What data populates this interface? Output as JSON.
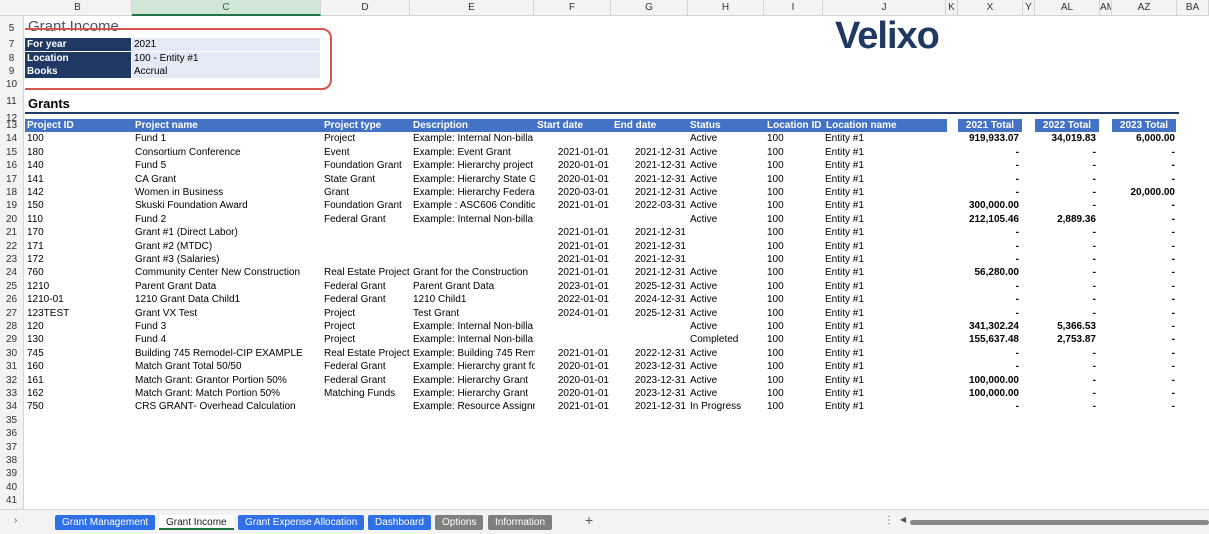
{
  "columns": [
    "B",
    "C",
    "D",
    "E",
    "F",
    "G",
    "H",
    "I",
    "J",
    "K",
    "X",
    "Y",
    "AL",
    "AM",
    "AZ",
    "BA"
  ],
  "selected_column": "C",
  "row_numbers": [
    "5",
    "7",
    "8",
    "9",
    "10",
    "11",
    "12",
    "13",
    "14",
    "15",
    "16",
    "17",
    "18",
    "19",
    "20",
    "21",
    "22",
    "23",
    "24",
    "25",
    "26",
    "27",
    "28",
    "29",
    "30",
    "31",
    "32",
    "33",
    "34",
    "35",
    "36",
    "37",
    "38",
    "39",
    "40",
    "41"
  ],
  "sheet_title": "Grant Income",
  "params": [
    {
      "label": "For year",
      "value": "2021"
    },
    {
      "label": "Location",
      "value": "100 - Entity #1"
    },
    {
      "label": "Books",
      "value": "Accrual"
    }
  ],
  "logo_text": "Velixo",
  "grants_title": "Grants",
  "table": {
    "headers": [
      "Project ID",
      "Project name",
      "Project type",
      "Description",
      "Start date",
      "End date",
      "Status",
      "Location ID",
      "Location name"
    ],
    "total_headers": [
      "2021 Total",
      "2022 Total",
      "2023 Total"
    ],
    "rows": [
      {
        "id": "100",
        "name": "Fund 1",
        "type": "Project",
        "desc": "Example: Internal Non-billa",
        "start": "",
        "end": "",
        "status": "Active",
        "loc": "100",
        "locname": "Entity #1",
        "t2021": "919,933.07",
        "t2022": "34,019.83",
        "t2023": "6,000.00"
      },
      {
        "id": "180",
        "name": "Consortium Conference",
        "type": "Event",
        "desc": "Example: Event Grant",
        "start": "2021-01-01",
        "end": "2021-12-31",
        "status": "Active",
        "loc": "100",
        "locname": "Entity #1",
        "t2021": "-",
        "t2022": "-",
        "t2023": "-"
      },
      {
        "id": "140",
        "name": "Fund 5",
        "type": "Foundation Grant",
        "desc": "Example: Hierarchy project",
        "start": "2020-01-01",
        "end": "2021-12-31",
        "status": "Active",
        "loc": "100",
        "locname": "Entity #1",
        "t2021": "-",
        "t2022": "-",
        "t2023": "-"
      },
      {
        "id": "141",
        "name": "CA Grant",
        "type": "State Grant",
        "desc": "Example: Hierarchy State G",
        "start": "2020-01-01",
        "end": "2021-12-31",
        "status": "Active",
        "loc": "100",
        "locname": "Entity #1",
        "t2021": "-",
        "t2022": "-",
        "t2023": "-"
      },
      {
        "id": "142",
        "name": "Women in Business",
        "type": "Grant",
        "desc": "Example: Hierarchy Federa",
        "start": "2020-03-01",
        "end": "2021-12-31",
        "status": "Active",
        "loc": "100",
        "locname": "Entity #1",
        "t2021": "-",
        "t2022": "-",
        "t2023": "20,000.00"
      },
      {
        "id": "150",
        "name": "Skuski Foundation Award",
        "type": "Foundation Grant",
        "desc": "Example : ASC606 Conditic",
        "start": "2021-01-01",
        "end": "2022-03-31",
        "status": "Active",
        "loc": "100",
        "locname": "Entity #1",
        "t2021": "300,000.00",
        "t2022": "-",
        "t2023": "-"
      },
      {
        "id": "110",
        "name": "Fund 2",
        "type": "Federal Grant",
        "desc": "Example: Internal Non-billa",
        "start": "",
        "end": "",
        "status": "Active",
        "loc": "100",
        "locname": "Entity #1",
        "t2021": "212,105.46",
        "t2022": "2,889.36",
        "t2023": "-"
      },
      {
        "id": "170",
        "name": "Grant #1 (Direct Labor)",
        "type": "",
        "desc": "",
        "start": "2021-01-01",
        "end": "2021-12-31",
        "status": "",
        "loc": "100",
        "locname": "Entity #1",
        "t2021": "-",
        "t2022": "-",
        "t2023": "-"
      },
      {
        "id": "171",
        "name": "Grant #2 (MTDC)",
        "type": "",
        "desc": "",
        "start": "2021-01-01",
        "end": "2021-12-31",
        "status": "",
        "loc": "100",
        "locname": "Entity #1",
        "t2021": "-",
        "t2022": "-",
        "t2023": "-"
      },
      {
        "id": "172",
        "name": "Grant #3 (Salaries)",
        "type": "",
        "desc": "",
        "start": "2021-01-01",
        "end": "2021-12-31",
        "status": "",
        "loc": "100",
        "locname": "Entity #1",
        "t2021": "-",
        "t2022": "-",
        "t2023": "-"
      },
      {
        "id": "760",
        "name": "Community Center New Construction",
        "type": "Real Estate Project",
        "desc": "Grant for the Construction",
        "start": "2021-01-01",
        "end": "2021-12-31",
        "status": "Active",
        "loc": "100",
        "locname": "Entity #1",
        "t2021": "56,280.00",
        "t2022": "-",
        "t2023": "-"
      },
      {
        "id": "1210",
        "name": "Parent Grant Data",
        "type": "Federal Grant",
        "desc": "Parent Grant Data",
        "start": "2023-01-01",
        "end": "2025-12-31",
        "status": "Active",
        "loc": "100",
        "locname": "Entity #1",
        "t2021": "-",
        "t2022": "-",
        "t2023": "-"
      },
      {
        "id": "1210-01",
        "name": "1210 Grant Data Child1",
        "type": "Federal Grant",
        "desc": "1210 Child1",
        "start": "2022-01-01",
        "end": "2024-12-31",
        "status": "Active",
        "loc": "100",
        "locname": "Entity #1",
        "t2021": "-",
        "t2022": "-",
        "t2023": "-"
      },
      {
        "id": "123TEST",
        "name": "Grant VX Test",
        "type": "Project",
        "desc": "Test Grant",
        "start": "2024-01-01",
        "end": "2025-12-31",
        "status": "Active",
        "loc": "100",
        "locname": "Entity #1",
        "t2021": "-",
        "t2022": "-",
        "t2023": "-"
      },
      {
        "id": "120",
        "name": "Fund 3",
        "type": "Project",
        "desc": "Example: Internal Non-billa",
        "start": "",
        "end": "",
        "status": "Active",
        "loc": "100",
        "locname": "Entity #1",
        "t2021": "341,302.24",
        "t2022": "5,366.53",
        "t2023": "-"
      },
      {
        "id": "130",
        "name": "Fund 4",
        "type": "Project",
        "desc": "Example: Internal Non-billa",
        "start": "",
        "end": "",
        "status": "Completed",
        "loc": "100",
        "locname": "Entity #1",
        "t2021": "155,637.48",
        "t2022": "2,753.87",
        "t2023": "-"
      },
      {
        "id": "745",
        "name": "Building 745 Remodel-CIP EXAMPLE",
        "type": "Real Estate Project",
        "desc": "Example: Building 745 Rem",
        "start": "2021-01-01",
        "end": "2022-12-31",
        "status": "Active",
        "loc": "100",
        "locname": "Entity #1",
        "t2021": "-",
        "t2022": "-",
        "t2023": "-"
      },
      {
        "id": "160",
        "name": "Match Grant Total 50/50",
        "type": "Federal Grant",
        "desc": "Example: Hierarchy grant fo",
        "start": "2020-01-01",
        "end": "2023-12-31",
        "status": "Active",
        "loc": "100",
        "locname": "Entity #1",
        "t2021": "-",
        "t2022": "-",
        "t2023": "-"
      },
      {
        "id": "161",
        "name": "Match Grant: Grantor Portion 50%",
        "type": "Federal Grant",
        "desc": "Example: Hierarchy Grant",
        "start": "2020-01-01",
        "end": "2023-12-31",
        "status": "Active",
        "loc": "100",
        "locname": "Entity #1",
        "t2021": "100,000.00",
        "t2022": "-",
        "t2023": "-"
      },
      {
        "id": "162",
        "name": "Match Grant: Match Portion 50%",
        "type": "Matching Funds",
        "desc": "Example: Hierarchy Grant",
        "start": "2020-01-01",
        "end": "2023-12-31",
        "status": "Active",
        "loc": "100",
        "locname": "Entity #1",
        "t2021": "100,000.00",
        "t2022": "-",
        "t2023": "-"
      },
      {
        "id": "750",
        "name": "CRS GRANT- Overhead Calculation",
        "type": "",
        "desc": "Example: Resource Assignr",
        "start": "2021-01-01",
        "end": "2021-12-31",
        "status": "In Progress",
        "loc": "100",
        "locname": "Entity #1",
        "t2021": "-",
        "t2022": "-",
        "t2023": "-"
      }
    ]
  },
  "tabs": [
    {
      "label": "Grant Management",
      "style": "blue"
    },
    {
      "label": "Grant Income",
      "style": "active"
    },
    {
      "label": "Grant Expense Allocation",
      "style": "blue"
    },
    {
      "label": "Dashboard",
      "style": "blue"
    },
    {
      "label": "Options",
      "style": "gray"
    },
    {
      "label": "Information",
      "style": "gray"
    }
  ],
  "add_sheet_glyph": "+",
  "scroll_left_glyph": "›",
  "hscroll_dots": "⋮",
  "hscroll_left_glyph": "◀"
}
